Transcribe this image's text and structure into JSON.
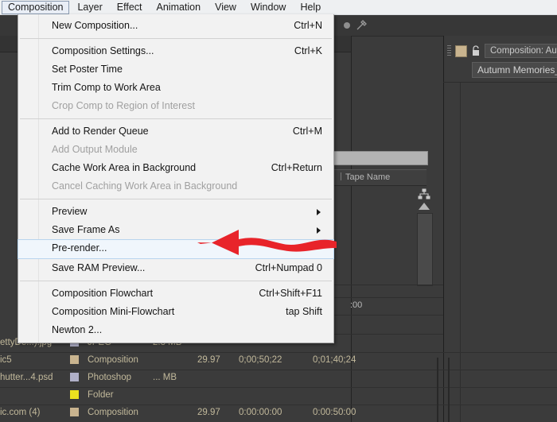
{
  "menubar": {
    "items": [
      {
        "label": "Composition",
        "active": true
      },
      {
        "label": "Layer",
        "active": false
      },
      {
        "label": "Effect",
        "active": false
      },
      {
        "label": "Animation",
        "active": false
      },
      {
        "label": "View",
        "active": false
      },
      {
        "label": "Window",
        "active": false
      },
      {
        "label": "Help",
        "active": false
      }
    ]
  },
  "dropdown": {
    "groups": [
      [
        {
          "label": "New Composition...",
          "accel": "Ctrl+N",
          "disabled": false,
          "submenu": false,
          "highlight": false
        }
      ],
      [
        {
          "label": "Composition Settings...",
          "accel": "Ctrl+K",
          "disabled": false,
          "submenu": false,
          "highlight": false
        },
        {
          "label": "Set Poster Time",
          "accel": "",
          "disabled": false,
          "submenu": false,
          "highlight": false
        },
        {
          "label": "Trim Comp to Work Area",
          "accel": "",
          "disabled": false,
          "submenu": false,
          "highlight": false
        },
        {
          "label": "Crop Comp to Region of Interest",
          "accel": "",
          "disabled": true,
          "submenu": false,
          "highlight": false
        }
      ],
      [
        {
          "label": "Add to Render Queue",
          "accel": "Ctrl+M",
          "disabled": false,
          "submenu": false,
          "highlight": false
        },
        {
          "label": "Add Output Module",
          "accel": "",
          "disabled": true,
          "submenu": false,
          "highlight": false
        },
        {
          "label": "Cache Work Area in Background",
          "accel": "Ctrl+Return",
          "disabled": false,
          "submenu": false,
          "highlight": false
        },
        {
          "label": "Cancel Caching Work Area in Background",
          "accel": "",
          "disabled": true,
          "submenu": false,
          "highlight": false
        }
      ],
      [
        {
          "label": "Preview",
          "accel": "",
          "disabled": false,
          "submenu": true,
          "highlight": false
        },
        {
          "label": "Save Frame As",
          "accel": "",
          "disabled": false,
          "submenu": true,
          "highlight": false
        },
        {
          "label": "Pre-render...",
          "accel": "",
          "disabled": false,
          "submenu": false,
          "highlight": true
        },
        {
          "label": "Save RAM Preview...",
          "accel": "Ctrl+Numpad 0",
          "disabled": false,
          "submenu": false,
          "highlight": false
        }
      ],
      [
        {
          "label": "Composition Flowchart",
          "accel": "Ctrl+Shift+F11",
          "disabled": false,
          "submenu": false,
          "highlight": false
        },
        {
          "label": "Composition Mini-Flowchart",
          "accel": "tap Shift",
          "disabled": false,
          "submenu": false,
          "highlight": false
        },
        {
          "label": "Newton 2...",
          "accel": "",
          "disabled": false,
          "submenu": false,
          "highlight": false
        }
      ]
    ]
  },
  "project_panel": {
    "column_header": "Tape Name",
    "timecode_stub": ":00"
  },
  "comp_panel": {
    "title": "Composition: Autu",
    "subtitle": "Autumn Memories_Yala"
  },
  "asset_list": {
    "rows": [
      {
        "name": "ettyDe...).jpg",
        "chip": "#b0b0c8",
        "type": "JPEG",
        "size": "2.3 MB",
        "fps": "",
        "in": "",
        "out": ""
      },
      {
        "name": "ic5",
        "chip": "#c9b48f",
        "type": "Composition",
        "size": "",
        "fps": "29.97",
        "in": "0;00;50;22",
        "out": "0;01;40;24"
      },
      {
        "name": "hutter...4.psd",
        "chip": "#b0b0c8",
        "type": "Photoshop",
        "size": "... MB",
        "fps": "",
        "in": "",
        "out": ""
      },
      {
        "name": "",
        "chip": "#ece21f",
        "type": "Folder",
        "size": "",
        "fps": "",
        "in": "",
        "out": ""
      },
      {
        "name": "ic.com (4)",
        "chip": "#c9b48f",
        "type": "Composition",
        "size": "",
        "fps": "29.97",
        "in": "0:00:00:00",
        "out": "0:00:50:00"
      }
    ]
  },
  "annotation": {
    "arrow_color": "#e8242a",
    "points_to": "Pre-render..."
  }
}
